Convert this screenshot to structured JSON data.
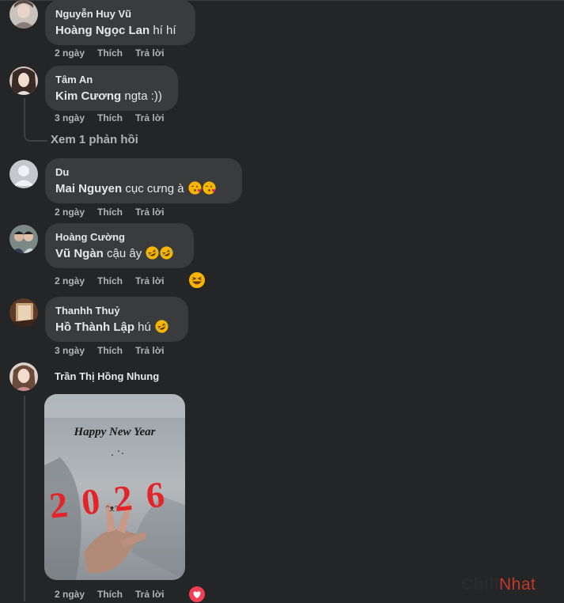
{
  "comments": [
    {
      "author": "Nguyễn Huy Vũ",
      "mention": "Hoàng Ngọc Lan",
      "text": " hí hí",
      "time": "2 ngày",
      "like": "Thích",
      "reply": "Trả lời"
    },
    {
      "author": "Tâm An",
      "mention": "Kim Cương",
      "text": " ngta :))",
      "time": "3 ngày",
      "like": "Thích",
      "reply": "Trả lời",
      "view_replies": "Xem 1 phản hồi"
    },
    {
      "author": "Du",
      "mention": "Mai Nguyen",
      "text": " cục cưng à ",
      "time": "2 ngày",
      "like": "Thích",
      "reply": "Trả lời",
      "emojis": [
        "kissing-heart-icon",
        "kissing-heart-icon"
      ]
    },
    {
      "author": "Hoàng Cường",
      "mention": "Vũ Ngàn",
      "text": " cậu ây ",
      "time": "2 ngày",
      "like": "Thích",
      "reply": "Trả lời",
      "emojis": [
        "rofl-icon",
        "rofl-icon"
      ],
      "reaction": "haha-reaction-icon"
    },
    {
      "author": "Thanhh Thuỷ",
      "mention": "Hồ Thành Lập",
      "text": " hú ",
      "time": "3 ngày",
      "like": "Thích",
      "reply": "Trả lời",
      "emojis": [
        "rofl-icon"
      ]
    },
    {
      "author": "Trần Thị Hồng Nhung",
      "time": "2 ngày",
      "like": "Thích",
      "reply": "Trả lời",
      "photo_caption": "Happy New Year",
      "photo_year": "2026",
      "reaction": "love-reaction-icon"
    }
  ],
  "watermark": {
    "part1": "Chill",
    "part2": "Nhat",
    "color1": "#2b2b2b",
    "color2": "#c0392b"
  },
  "colors": {
    "background": "#242526",
    "bubble": "#3a3b3c",
    "secondary_text": "#b0b3b8",
    "primary_text": "#e4e6eb"
  }
}
